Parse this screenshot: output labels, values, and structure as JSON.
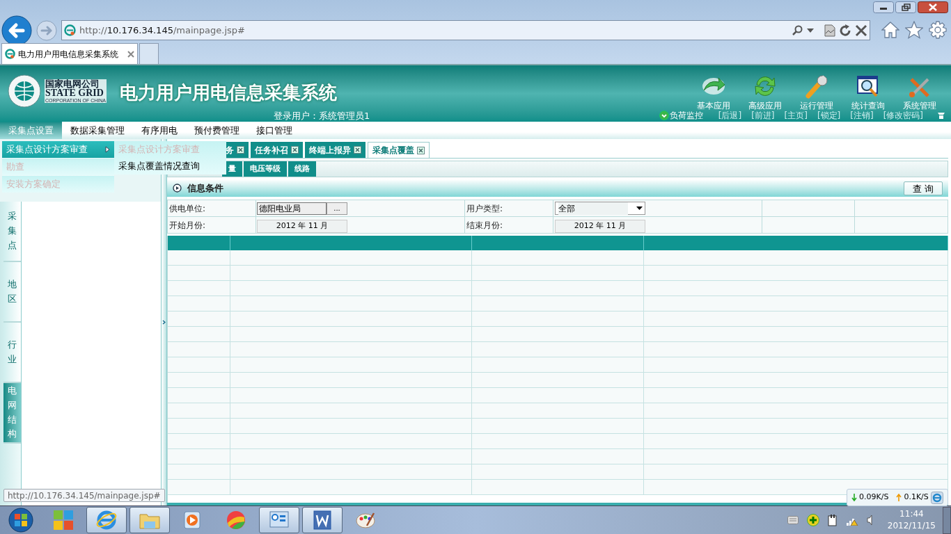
{
  "browser": {
    "address": "http://**10.176.34.145**/mainpage.jsp#",
    "tab_title": "电力用户用电信息采集系统"
  },
  "app": {
    "logo_cn": "国家电网公司",
    "logo_en": "STATE GRID",
    "logo_sub": "CORPORATION OF CHINA",
    "title": "电力用户用电信息采集系统",
    "login": "登录用户：系统管理员1"
  },
  "modules": [
    {
      "label": "基本应用",
      "kind": "swoosh"
    },
    {
      "label": "高级应用",
      "kind": "refresh"
    },
    {
      "label": "运行管理",
      "kind": "wrench"
    },
    {
      "label": "统计查询",
      "kind": "magnifier"
    },
    {
      "label": "系统管理",
      "kind": "tools"
    }
  ],
  "links": [
    {
      "label": "负荷监控",
      "icon": true
    },
    {
      "label": "[后退]",
      "icon": false
    },
    {
      "label": "[前进]",
      "icon": false
    },
    {
      "label": "[主页]",
      "icon": false
    },
    {
      "label": "[锁定]",
      "icon": false
    },
    {
      "label": "[注销]",
      "icon": false
    },
    {
      "label": "[修改密码]",
      "icon": false
    }
  ],
  "menu": [
    {
      "label": "采集点设置",
      "selected": true
    },
    {
      "label": "数据采集管理",
      "selected": false
    },
    {
      "label": "有序用电",
      "selected": false
    },
    {
      "label": "预付费管理",
      "selected": false
    },
    {
      "label": "接口管理",
      "selected": false
    }
  ],
  "dropdown": {
    "items": [
      {
        "label": "采集点设计方案审查",
        "selected": true,
        "disabled": false,
        "submenu": true
      },
      {
        "label": "勘查",
        "selected": false,
        "disabled": true,
        "submenu": false
      },
      {
        "label": "安装方案确定",
        "selected": false,
        "disabled": true,
        "submenu": false
      }
    ],
    "submenu": [
      {
        "label": "采集点设计方案审查",
        "disabled": true
      },
      {
        "label": "采集点覆盖情况查询",
        "disabled": false
      }
    ]
  },
  "page_tabs": [
    {
      "label": "务",
      "selected": false
    },
    {
      "label": "任务补召",
      "selected": false
    },
    {
      "label": "终端上报异",
      "selected": false
    },
    {
      "label": "采集点覆盖",
      "selected": true
    }
  ],
  "sub_tabs": [
    {
      "label": "量"
    },
    {
      "label": "电压等级"
    },
    {
      "label": "线路"
    }
  ],
  "side_tabs": [
    {
      "label": "采集点",
      "selected": false
    },
    {
      "label": "地区",
      "selected": false
    },
    {
      "label": "行业",
      "selected": false
    },
    {
      "label": "电网结构",
      "selected": true
    }
  ],
  "conditions": {
    "title": "信息条件",
    "query_button": "查 询",
    "supply_unit": {
      "label": "供电单位:",
      "value": "德阳电业局",
      "button": "..."
    },
    "user_type": {
      "label": "用户类型:",
      "value": "全部"
    },
    "start_month": {
      "label": "开始月份:",
      "value": "2012 年 11 月"
    },
    "end_month": {
      "label": "结束月份:",
      "value": "2012 年 11 月"
    }
  },
  "status_url": "http://10.176.34.145/mainpage.jsp#",
  "net_speed": {
    "down": "0.09K/S",
    "up": "0.1K/S"
  },
  "taskbar": [
    {
      "kind": "tiles",
      "open": false
    },
    {
      "kind": "ie",
      "open": true
    },
    {
      "kind": "folder",
      "open": true
    },
    {
      "kind": "media",
      "open": false
    },
    {
      "kind": "ball",
      "open": false
    },
    {
      "kind": "panel",
      "open": true
    },
    {
      "kind": "word",
      "open": true
    },
    {
      "kind": "paint",
      "open": false
    }
  ],
  "clock": {
    "time": "11:44",
    "date": "2012/11/15"
  }
}
